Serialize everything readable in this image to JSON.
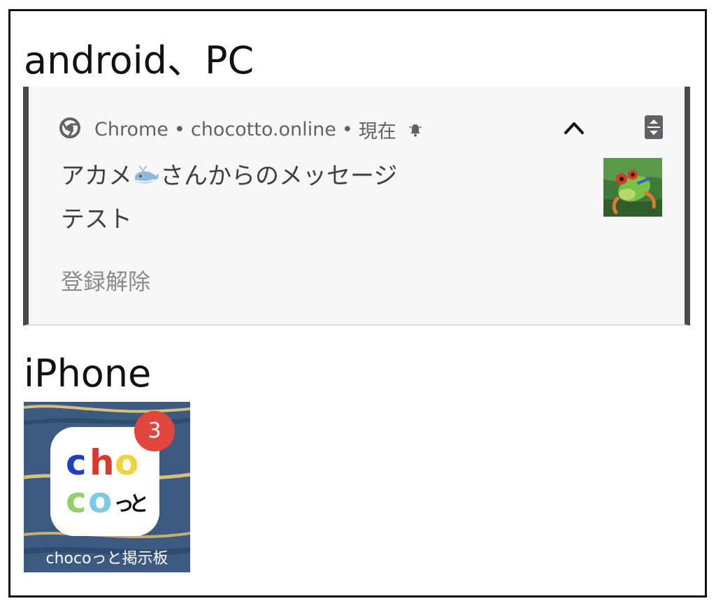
{
  "sections": {
    "android_heading": "android、PC",
    "iphone_heading": "iPhone"
  },
  "notification": {
    "app_name": "Chrome",
    "separator": "•",
    "site": "chocotto.online",
    "time": "現在",
    "title_before_emoji": "アカメ",
    "title_after_emoji": "さんからのメッセージ",
    "body": "テスト",
    "action_label": "登録解除",
    "icons": {
      "app": "chrome-icon",
      "alert": "bell-icon",
      "expand": "chevron-up-icon",
      "snooze": "snooze-icon",
      "emoji": "whale-emoji",
      "thumbnail": "frog-image"
    }
  },
  "ios_app": {
    "label": "chocoっと掲示板",
    "badge_count": "3",
    "logo_letters": [
      "c",
      "h",
      "o",
      "c",
      "o",
      "っ",
      "と"
    ],
    "colors": {
      "wallpaper": "#3d5a80",
      "badge": "#e0463b",
      "logo_c": "#1e3fbf",
      "logo_h": "#d93a2f",
      "logo_o": "#f2d33a",
      "logo_c2": "#8fd16a",
      "logo_o2": "#7fc8e8"
    }
  },
  "colors": {
    "frame": "#111111",
    "notification_bg": "#f7f7f7",
    "notification_side": "#4a4a4a",
    "secondary_text": "#5f6368",
    "action_text": "#8a8a8a"
  }
}
